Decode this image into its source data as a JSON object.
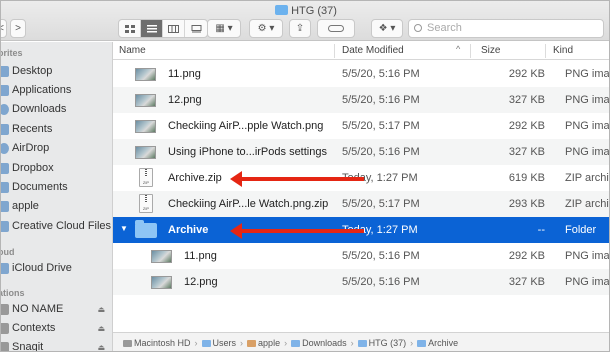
{
  "window": {
    "title": "HTG (37)"
  },
  "toolbar": {
    "back": "<",
    "forward": ">",
    "search_placeholder": "Search"
  },
  "sidebar": {
    "sections": [
      {
        "label": "orites"
      },
      {
        "label": "oud"
      },
      {
        "label": "ations"
      }
    ],
    "favorites": [
      {
        "label": "Desktop"
      },
      {
        "label": "Applications"
      },
      {
        "label": "Downloads"
      },
      {
        "label": "Recents"
      },
      {
        "label": "AirDrop"
      },
      {
        "label": "Dropbox"
      },
      {
        "label": "Documents"
      },
      {
        "label": "apple"
      },
      {
        "label": "Creative Cloud Files"
      }
    ],
    "icloud": [
      {
        "label": "iCloud Drive"
      }
    ],
    "locations": [
      {
        "label": "NO NAME"
      },
      {
        "label": "Contexts"
      },
      {
        "label": "Snagit"
      }
    ]
  },
  "columns": {
    "name": "Name",
    "date": "Date Modified",
    "size": "Size",
    "kind": "Kind"
  },
  "files": [
    {
      "name": "11.png",
      "date": "5/5/20, 5:16 PM",
      "size": "292 KB",
      "kind": "PNG image"
    },
    {
      "name": "12.png",
      "date": "5/5/20, 5:16 PM",
      "size": "327 KB",
      "kind": "PNG image"
    },
    {
      "name": "Checkiing AirP...pple Watch.png",
      "date": "5/5/20, 5:17 PM",
      "size": "292 KB",
      "kind": "PNG image"
    },
    {
      "name": "Using iPhone to...irPods settings",
      "date": "5/5/20, 5:16 PM",
      "size": "327 KB",
      "kind": "PNG image"
    },
    {
      "name": "Archive.zip",
      "date": "Today, 1:27 PM",
      "size": "619 KB",
      "kind": "ZIP archive"
    },
    {
      "name": "Checkiing AirP...le Watch.png.zip",
      "date": "5/5/20, 5:17 PM",
      "size": "293 KB",
      "kind": "ZIP archive"
    },
    {
      "name": "Archive",
      "date": "Today, 1:27 PM",
      "size": "--",
      "kind": "Folder"
    },
    {
      "name": "11.png",
      "date": "5/5/20, 5:16 PM",
      "size": "292 KB",
      "kind": "PNG image"
    },
    {
      "name": "12.png",
      "date": "5/5/20, 5:16 PM",
      "size": "327 KB",
      "kind": "PNG image"
    }
  ],
  "pathbar": [
    "Macintosh HD",
    "Users",
    "apple",
    "Downloads",
    "HTG (37)",
    "Archive"
  ],
  "colors": {
    "selection": "#0b63d5",
    "arrow": "#e52613"
  }
}
